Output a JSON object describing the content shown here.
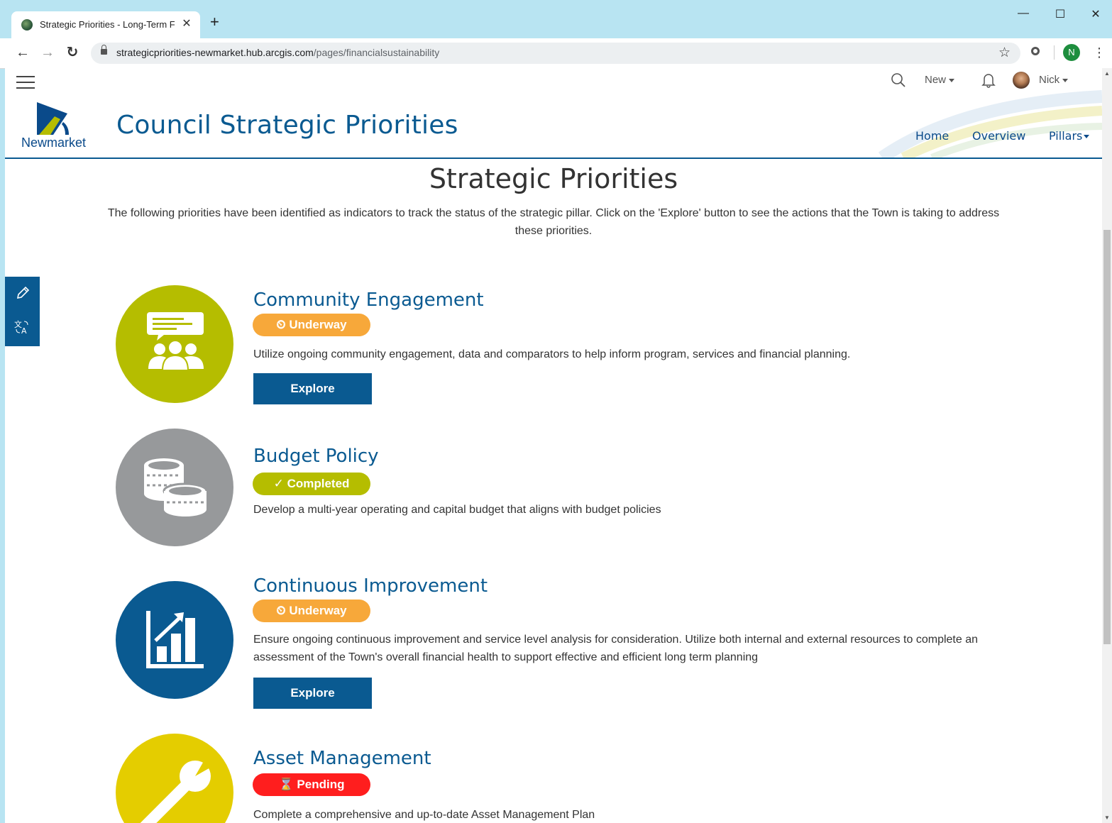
{
  "browser": {
    "tab_title": "Strategic Priorities - Long-Term F",
    "tab_close": "✕",
    "new_tab": "+",
    "url_domain": "strategicpriorities-newmarket.hub.arcgis.com",
    "url_path": "/pages/financialsustainability",
    "profile_initial": "N",
    "min": "—",
    "max": "☐",
    "close": "✕"
  },
  "topbar": {
    "new_label": "New",
    "user_name": "Nick"
  },
  "header": {
    "logo_text": "Newmarket",
    "site_title": "Council Strategic Priorities",
    "nav": [
      {
        "label": "Home"
      },
      {
        "label": "Overview"
      },
      {
        "label": "Pillars"
      }
    ]
  },
  "page": {
    "heading": "Strategic Priorities",
    "intro": "The following priorities have been identified as indicators to track the status of the strategic pillar. Click on the 'Explore' button to see the actions that the Town is taking to address these priorities."
  },
  "priorities": [
    {
      "name": "Community Engagement",
      "status": "Underway",
      "status_icon": "⏲",
      "description": "Utilize ongoing community engagement, data and comparators to help inform program, services and financial planning.",
      "button": "Explore",
      "circle_color": "#b5bd00",
      "badge_color": "#f7a83a"
    },
    {
      "name": "Budget Policy",
      "status": "Completed",
      "status_icon": "✓",
      "description": "Develop a multi-year operating and capital budget that aligns with budget policies",
      "circle_color": "#97999b",
      "badge_color": "#b5bd00"
    },
    {
      "name": "Continuous Improvement",
      "status": "Underway",
      "status_icon": "⏲",
      "description": "Ensure ongoing continuous improvement and service level analysis for consideration. Utilize both internal and external resources to complete an assessment of the Town's overall financial health to support effective and efficient long term planning",
      "button": "Explore",
      "circle_color": "#0a5a91",
      "badge_color": "#f7a83a"
    },
    {
      "name": "Asset Management",
      "status": "Pending",
      "status_icon": "⌛",
      "description": "Complete a comprehensive and up-to-date Asset Management Plan",
      "circle_color": "#e4cd00",
      "badge_color": "#ff1e1e"
    }
  ]
}
